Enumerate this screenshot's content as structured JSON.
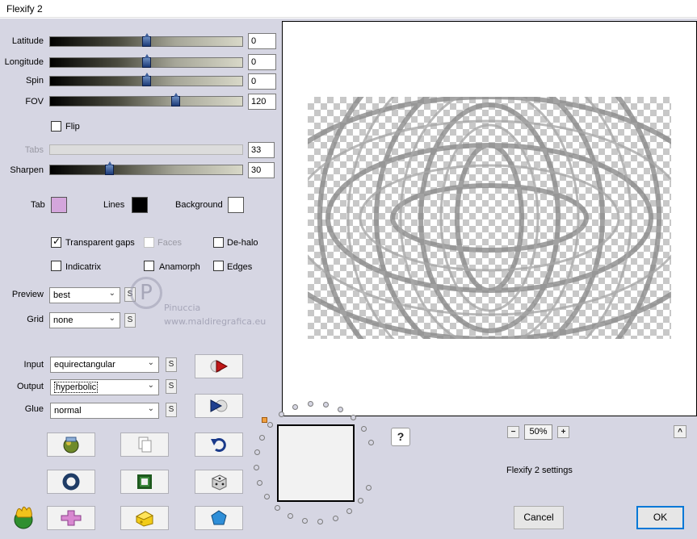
{
  "window": {
    "title": "Flexify 2"
  },
  "sliders": [
    {
      "label": "Latitude",
      "value": "0",
      "level": 0.5
    },
    {
      "label": "Longitude",
      "value": "0",
      "level": 0.5
    },
    {
      "label": "Spin",
      "value": "0",
      "level": 0.5
    },
    {
      "label": "FOV",
      "value": "120",
      "level": 0.66
    },
    {
      "label": "Tabs",
      "value": "33",
      "level": 0.33,
      "disabled": true
    },
    {
      "label": "Sharpen",
      "value": "30",
      "level": 0.3
    }
  ],
  "flip": {
    "label": "Flip",
    "checked": false
  },
  "colors": {
    "tab": {
      "label": "Tab",
      "color": "#d4a6dc"
    },
    "lines": {
      "label": "Lines",
      "color": "#000000"
    },
    "background": {
      "label": "Background",
      "color": "#ffffff"
    }
  },
  "options": {
    "transparent_gaps": {
      "label": "Transparent gaps",
      "checked": true
    },
    "faces": {
      "label": "Faces",
      "checked": false,
      "disabled": true
    },
    "de_halo": {
      "label": "De-halo",
      "checked": false
    },
    "indicatrix": {
      "label": "Indicatrix",
      "checked": false
    },
    "anamorph": {
      "label": "Anamorph",
      "checked": false
    },
    "edges": {
      "label": "Edges",
      "checked": false
    }
  },
  "preview": {
    "label": "Preview",
    "value": "best"
  },
  "grid": {
    "label": "Grid",
    "value": "none"
  },
  "input": {
    "label": "Input",
    "value": "equirectangular"
  },
  "output": {
    "label": "Output",
    "value": "hyperbolic"
  },
  "glue": {
    "label": "Glue",
    "value": "normal"
  },
  "s_button": "S",
  "zoom": {
    "minus": "−",
    "value": "50%",
    "plus": "+"
  },
  "help": "?",
  "collapse": "^",
  "settings_name": "Flexify 2 settings",
  "buttons": {
    "cancel": "Cancel",
    "ok": "OK"
  },
  "watermark": {
    "line1": "Pinuccia",
    "line2": "www.maldiregrafica.eu"
  },
  "icon_names": [
    "randomize-ball-icon",
    "copy-page-icon",
    "undo-arrow-icon",
    "ring-icon",
    "green-square-icon",
    "dice-icon",
    "flame-logo-icon",
    "pink-cross-icon",
    "cheese-icon",
    "gem-icon",
    "play-red-icon",
    "play-blue-icon"
  ]
}
